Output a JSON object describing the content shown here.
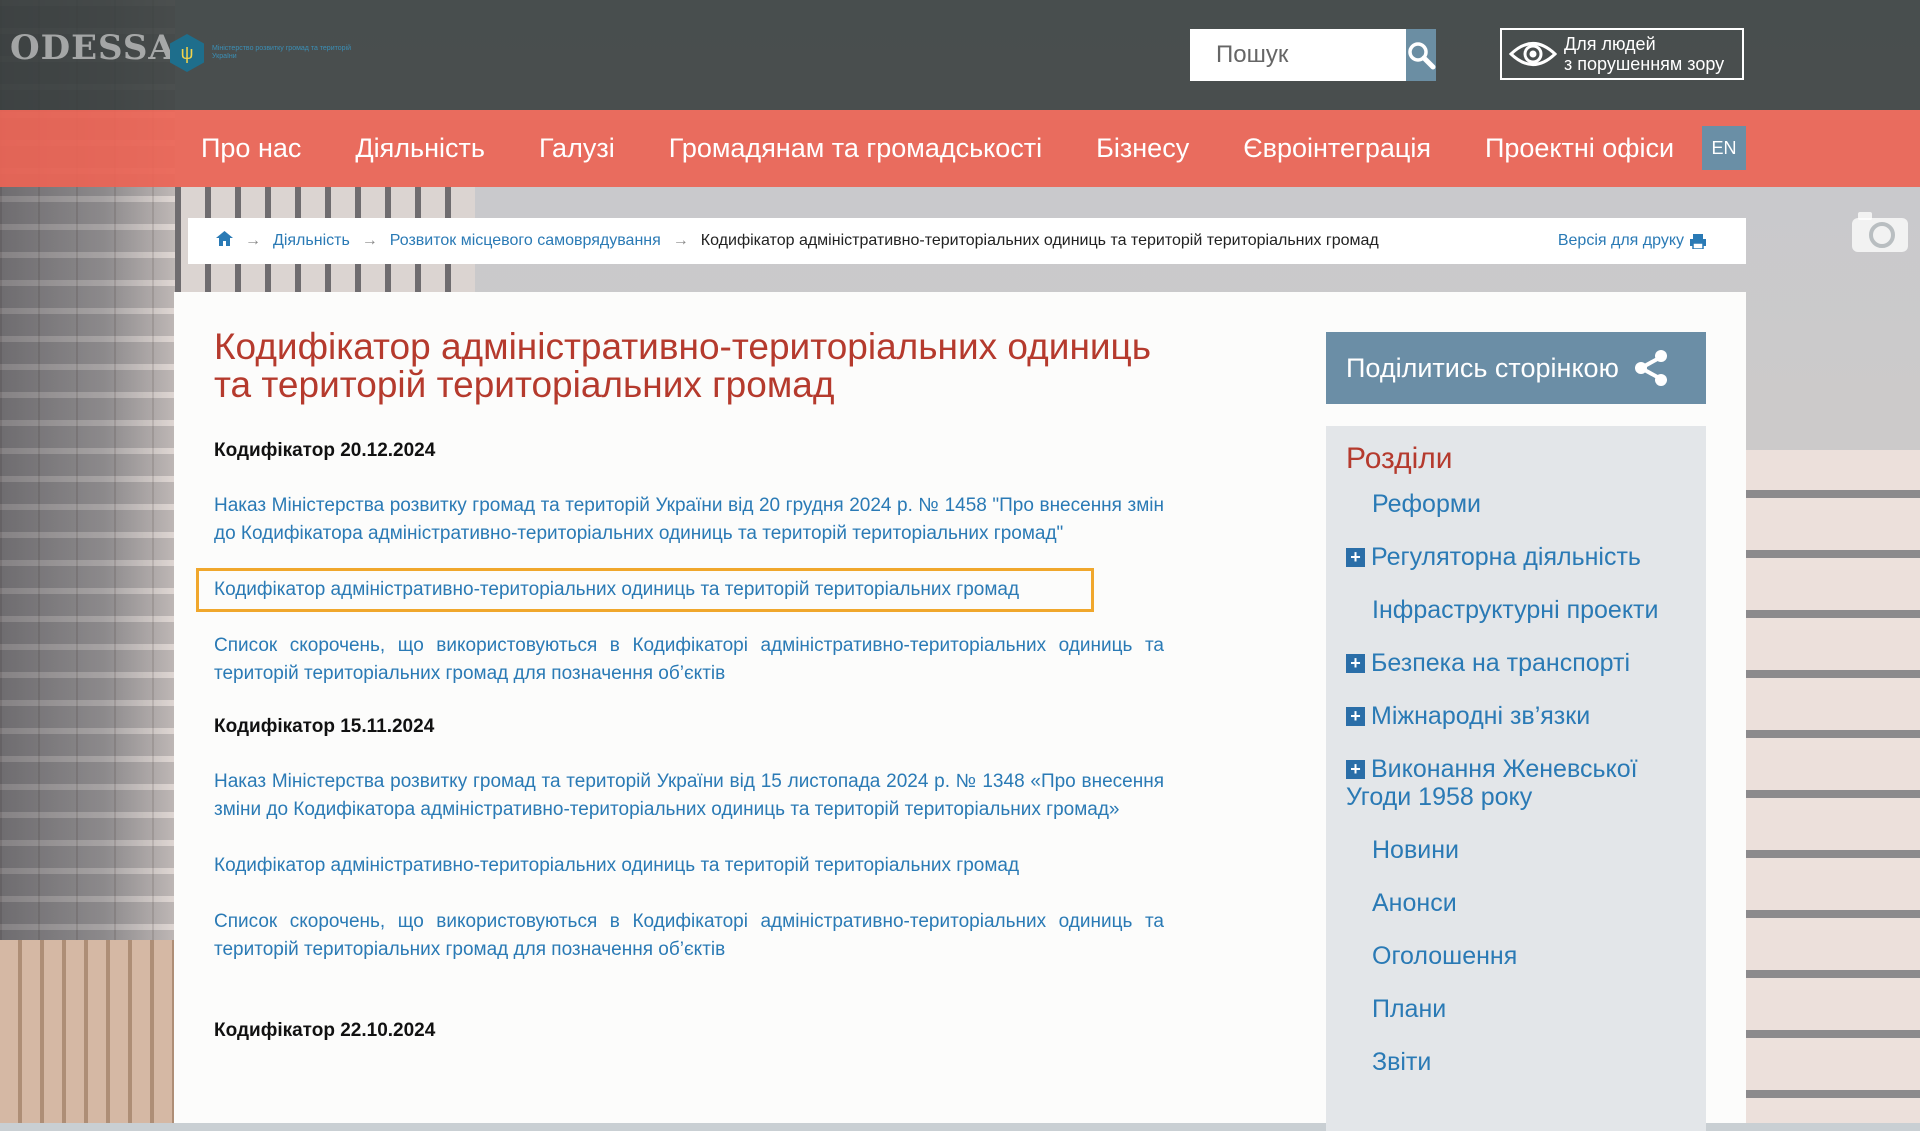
{
  "brand": {
    "city_sign": "ODESSA",
    "ministry_name": "Міністерство розвитку громад та територій України"
  },
  "search": {
    "placeholder": "Пошук"
  },
  "accessibility": {
    "line1": "Для людей",
    "line2": "з порушенням зору"
  },
  "nav": {
    "items": [
      "Про нас",
      "Діяльність",
      "Галузі",
      "Громадянам та громадськості",
      "Бізнесу",
      "Євроінтеграція",
      "Проектні офіси"
    ],
    "lang": "EN"
  },
  "breadcrumb": {
    "items": [
      "Діяльність",
      "Розвиток місцевого самоврядування"
    ],
    "current": "Кодифікатор адміністративно-територіальних одиниць та територій територіальних громад",
    "print": "Версія для друку"
  },
  "page": {
    "title": "Кодифікатор адміністративно-територіальних одиниць та територій територіальних громад"
  },
  "groups": [
    {
      "heading": "Кодифікатор 20.12.2024",
      "links": [
        "Наказ Міністерства розвитку громад та територій України від 20 грудня 2024 р. № 1458 \"Про внесення змін до Кодифікатора адміністративно-територіальних одиниць та територій територіальних громад\"",
        "Кодифікатор адміністративно-територіальних одиниць та територій територіальних громад",
        "Список скорочень, що використовуються в Кодифікаторі адміністративно-територіальних одиниць та територій територіальних громад для позначення об’єктів"
      ]
    },
    {
      "heading": "Кодифікатор 15.11.2024",
      "links": [
        "Наказ Міністерства розвитку громад та територій України від 15 листопада 2024 р. № 1348 «Про внесення зміни до Кодифікатора адміністративно-територіальних одиниць та територій територіальних громад»",
        "Кодифікатор адміністративно-територіальних одиниць та територій територіальних громад",
        "Список скорочень, що використовуються в Кодифікаторі адміністративно-територіальних одиниць та територій територіальних громад для позначення об’єктів"
      ]
    },
    {
      "heading": "Кодифікатор 22.10.2024",
      "links": []
    }
  ],
  "sidebar": {
    "share": "Поділитись сторінкою",
    "sections_title": "Розділи",
    "items": [
      {
        "label": "Реформи",
        "expandable": false
      },
      {
        "label": "Регуляторна діяльність",
        "expandable": true
      },
      {
        "label": "Інфраструктурні проекти",
        "expandable": false
      },
      {
        "label": "Безпека на транспорті",
        "expandable": true
      },
      {
        "label": "Міжнародні зв’язки",
        "expandable": true
      },
      {
        "label": "Виконання Женевської Угоди 1958 року",
        "expandable": true
      },
      {
        "label": "Новини",
        "expandable": false
      },
      {
        "label": "Анонси",
        "expandable": false
      },
      {
        "label": "Оголошення",
        "expandable": false
      },
      {
        "label": "Плани",
        "expandable": false
      },
      {
        "label": "Звіти",
        "expandable": false
      }
    ]
  },
  "colors": {
    "header": "#3a3f40",
    "nav": "#eb6455",
    "link": "#2a7ab5",
    "title": "#b53a2d",
    "highlight": "#f0a72c",
    "accent": "#6b8ea6"
  }
}
